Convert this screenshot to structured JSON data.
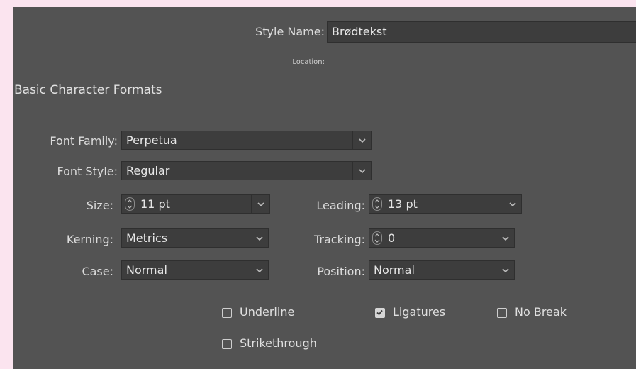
{
  "style_name": {
    "label": "Style Name:",
    "value": "Brødtekst"
  },
  "location": {
    "label": "Location:"
  },
  "section_title": "Basic Character Formats",
  "font_family": {
    "label": "Font Family:",
    "value": "Perpetua"
  },
  "font_style": {
    "label": "Font Style:",
    "value": "Regular"
  },
  "size": {
    "label": "Size:",
    "value": "11 pt"
  },
  "leading": {
    "label": "Leading:",
    "value": "13 pt"
  },
  "kerning": {
    "label": "Kerning:",
    "value": "Metrics"
  },
  "tracking": {
    "label": "Tracking:",
    "value": "0"
  },
  "case": {
    "label": "Case:",
    "value": "Normal"
  },
  "position": {
    "label": "Position:",
    "value": "Normal"
  },
  "checkboxes": {
    "underline": {
      "label": "Underline",
      "checked": false
    },
    "ligatures": {
      "label": "Ligatures",
      "checked": true
    },
    "no_break": {
      "label": "No Break",
      "checked": false
    },
    "strikethrough": {
      "label": "Strikethrough",
      "checked": false
    }
  },
  "colors": {
    "panel": "#535353",
    "field": "#3d3d3d",
    "page": "#fbe4ef"
  }
}
